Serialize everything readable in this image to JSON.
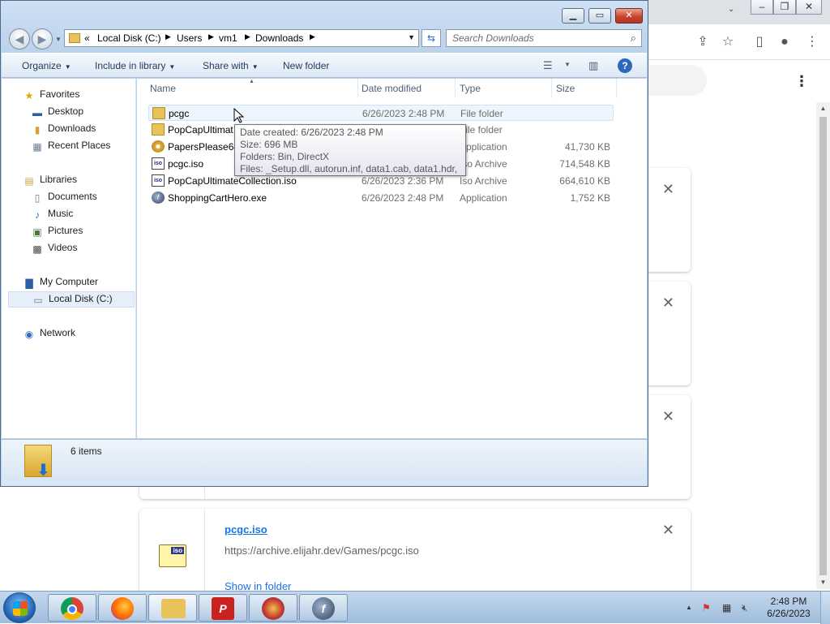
{
  "chrome": {
    "download_card": {
      "file_name": "pcgc.iso",
      "url": "https://archive.elijahr.dev/Games/pcgc.iso",
      "show_in_folder": "Show in folder",
      "icon_label": "iso"
    }
  },
  "explorer": {
    "breadcrumb": [
      "«",
      "Local Disk (C:)",
      "Users",
      "vm1",
      "Downloads"
    ],
    "search_placeholder": "Search Downloads",
    "commands": {
      "organize": "Organize",
      "include_in_library": "Include in library",
      "share_with": "Share with",
      "new_folder": "New folder"
    },
    "nav": {
      "favorites": "Favorites",
      "desktop": "Desktop",
      "downloads": "Downloads",
      "recent_places": "Recent Places",
      "libraries": "Libraries",
      "documents": "Documents",
      "music": "Music",
      "pictures": "Pictures",
      "videos": "Videos",
      "my_computer": "My Computer",
      "local_disk": "Local Disk (C:)",
      "network": "Network"
    },
    "columns": {
      "name": "Name",
      "date_modified": "Date modified",
      "type": "Type",
      "size": "Size"
    },
    "files": [
      {
        "name": "pcgc",
        "date": "6/26/2023 2:48 PM",
        "type": "File folder",
        "size": ""
      },
      {
        "name": "PopCapUltimat",
        "date": "",
        "type": "File folder",
        "size": ""
      },
      {
        "name": "PapersPlease64.",
        "date": "",
        "type": "Application",
        "size": "41,730 KB"
      },
      {
        "name": "pcgc.iso",
        "date": "",
        "type": "Iso Archive",
        "size": "714,548 KB"
      },
      {
        "name": "PopCapUltimateCollection.iso",
        "date": "6/26/2023 2:36 PM",
        "type": "Iso Archive",
        "size": "664,610 KB"
      },
      {
        "name": "ShoppingCartHero.exe",
        "date": "6/26/2023 2:48 PM",
        "type": "Application",
        "size": "1,752 KB"
      }
    ],
    "tooltip": {
      "line1": "Date created: 6/26/2023 2:48 PM",
      "line2": "Size: 696 MB",
      "line3": "Folders: Bin, DirectX",
      "line4": "Files: _Setup.dll, autorun.inf, data1.cab, data1.hdr, ..."
    },
    "status": {
      "item_count": "6 items"
    }
  },
  "taskbar": {
    "clock_time": "2:48 PM",
    "clock_date": "6/26/2023"
  }
}
